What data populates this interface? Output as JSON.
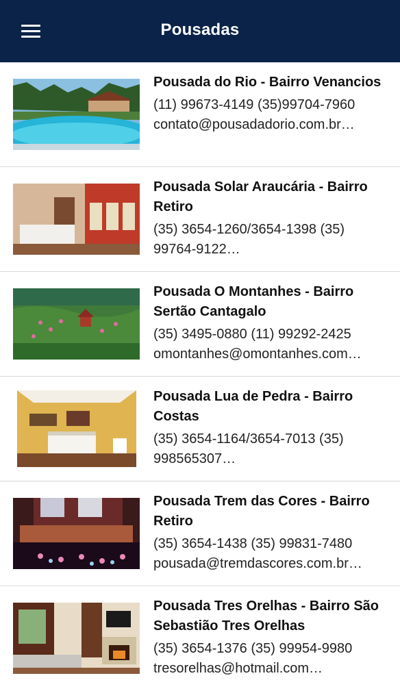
{
  "header": {
    "title": "Pousadas",
    "menu_icon": "hamburger-menu-icon"
  },
  "colors": {
    "app_bar": "#0b2348",
    "divider": "#d8d8d8"
  },
  "pousadas": [
    {
      "name": "Pousada do Rio - Bairro Venancios",
      "phones": "(11) 99673-4149 (35)99704-7960",
      "extra": "contato@pousadadorio.com.br…"
    },
    {
      "name": "Pousada Solar Araucária - Bairro Retiro",
      "phones": "(35) 3654-1260/3654-1398 (35)",
      "extra": "99764-9122…"
    },
    {
      "name": "Pousada O Montanhes - Bairro Sertão Cantagalo",
      "phones": "(35) 3495-0880 (11) 99292-2425",
      "extra": "omontanhes@omontanhes.com…"
    },
    {
      "name": "Pousada Lua de Pedra - Bairro Costas",
      "phones": "(35) 3654-1164/3654-7013 (35)",
      "extra": "998565307…"
    },
    {
      "name": "Pousada Trem das Cores - Bairro Retiro",
      "phones": "(35) 3654-1438 (35) 99831-7480",
      "extra": "pousada@tremdascores.com.br…"
    },
    {
      "name": "Pousada Tres Orelhas - Bairro São Sebastião Tres Orelhas",
      "phones": "(35) 3654-1376 (35) 99954-9980",
      "extra": "tresorelhas@hotmail.com…"
    }
  ]
}
